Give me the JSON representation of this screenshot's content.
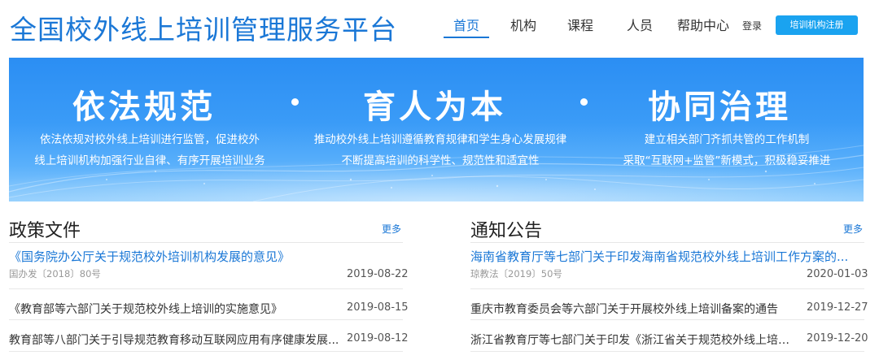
{
  "header": {
    "site_title": "全国校外线上培训管理服务平台",
    "nav": [
      "首页",
      "机构",
      "课程",
      "人员",
      "帮助中心"
    ],
    "login": "登录",
    "register": "培训机构注册"
  },
  "banner": {
    "columns": [
      {
        "heading": "依法规范",
        "lines": [
          "依法依规对校外线上培训进行监管，促进校外",
          "线上培训机构加强行业自律、有序开展培训业务"
        ]
      },
      {
        "heading": "育人为本",
        "lines": [
          "推动校外线上培训遵循教育规律和学生身心发展规律",
          "不断提高培训的科学性、规范性和适宜性"
        ]
      },
      {
        "heading": "协同治理",
        "lines": [
          "建立相关部门齐抓共管的工作机制",
          "采取“互联网+监管”新模式，积极稳妥推进"
        ]
      }
    ]
  },
  "policy": {
    "title": "政策文件",
    "more": "更多",
    "items": [
      {
        "title": "《国务院办公厅关于规范校外培训机构发展的意见》",
        "sub": "国办发〔2018〕80号",
        "date": "2019-08-22"
      },
      {
        "title": "《教育部等六部门关于规范校外线上培训的实施意见》",
        "sub": "",
        "date": "2019-08-15"
      },
      {
        "title": "教育部等八部门关于引导规范教育移动互联网应用有序健康发展...",
        "sub": "",
        "date": "2019-08-12"
      }
    ]
  },
  "notice": {
    "title": "通知公告",
    "more": "更多",
    "items": [
      {
        "title": "海南省教育厅等七部门关于印发海南省规范校外线上培训工作方案的...",
        "sub": "琼教法〔2019〕50号",
        "date": "2020-01-03"
      },
      {
        "title": "重庆市教育委员会等六部门关于开展校外线上培训备案的通告",
        "sub": "",
        "date": "2019-12-27"
      },
      {
        "title": "浙江省教育厅等七部门关于印发《浙江省关于规范校外线上培训...",
        "sub": "",
        "date": "2019-12-20"
      }
    ]
  },
  "colors": {
    "brand": "#1a77d6",
    "button": "#1aa3f0",
    "banner": "#3a9bf7"
  }
}
